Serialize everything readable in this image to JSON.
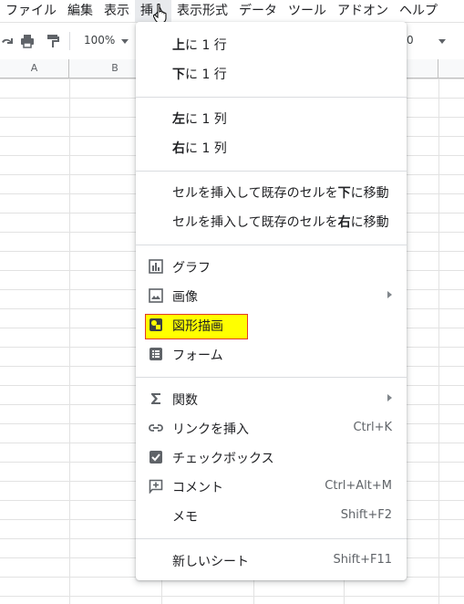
{
  "menubar": {
    "items": [
      "ファイル",
      "編集",
      "表示",
      "挿入",
      "表示形式",
      "データ",
      "ツール",
      "アドオン",
      "ヘルプ"
    ],
    "active_index": 3
  },
  "toolbar": {
    "zoom": "100%",
    "font_size_fragment": "0"
  },
  "columns": [
    "A",
    "B"
  ],
  "insert_menu": {
    "row_above": {
      "bold": "上",
      "rest": "に 1 行"
    },
    "row_below": {
      "bold": "下",
      "rest": "に 1 行"
    },
    "col_left": {
      "bold": "左",
      "rest": "に 1 列"
    },
    "col_right": {
      "bold": "右",
      "rest": "に 1 列"
    },
    "cells_shift_down": {
      "pre": "セルを挿入して既存のセルを",
      "bold": "下",
      "post": "に移動"
    },
    "cells_shift_right": {
      "pre": "セルを挿入して既存のセルを",
      "bold": "右",
      "post": "に移動"
    },
    "chart": "グラフ",
    "image": "画像",
    "drawing": "図形描画",
    "form": "フォーム",
    "function": "関数",
    "link": "リンクを挿入",
    "link_shortcut": "Ctrl+K",
    "checkbox": "チェックボックス",
    "comment": "コメント",
    "comment_shortcut": "Ctrl+Alt+M",
    "note": "メモ",
    "note_shortcut": "Shift+F2",
    "new_sheet": "新しいシート",
    "new_sheet_shortcut": "Shift+F11"
  },
  "highlight_color": "#ffff00",
  "highlight_border": "#e0392b"
}
